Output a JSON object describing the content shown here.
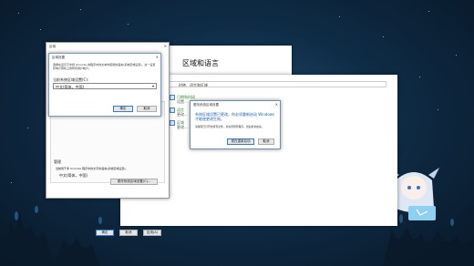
{
  "control_panel": {
    "title": "区域和语言",
    "breadcrumb": "时钟、语言和区域",
    "items": [
      {
        "label": "日期和时间",
        "sub": "设置..."
      },
      {
        "label": "语言",
        "sub": "更改..."
      },
      {
        "label": "区域",
        "sub": "更改..."
      }
    ]
  },
  "region_dialog": {
    "title": "区域",
    "tab": "管理",
    "section_text": "当前用于非 Unicode 程序中的文字的语言(系统区域设置)。",
    "current_value": "中文(简体，中国)",
    "change_locale_button": "更改系统区域设置(C)...",
    "ok_button": "确定",
    "cancel_button": "取消",
    "apply_button": "应用(A)"
  },
  "region_settings_dialog": {
    "title": "区域设置",
    "description": "选择在显示不支持 Unicode 的程序中的文本时使用的语言(系统区域设置)。这一设置影响计算机上的所有用户帐户。",
    "label": "当前系统区域设置(C):",
    "selected": "中文(简体，中国)",
    "ok_button": "确定",
    "cancel_button": "取消"
  },
  "restart_dialog": {
    "title": "更改系统区域设置",
    "main_text": "系统区域设置已更改。你必须重新启动 Windows 才能使更改生效。",
    "sub_text": "请保存已打开的所有文件，并关闭所有程序，然后重新启动。",
    "restart_button": "现在重新启动",
    "cancel_button": "取消"
  },
  "colors": {
    "accent": "#1a5fb4",
    "link_green": "#2e8a2e"
  }
}
